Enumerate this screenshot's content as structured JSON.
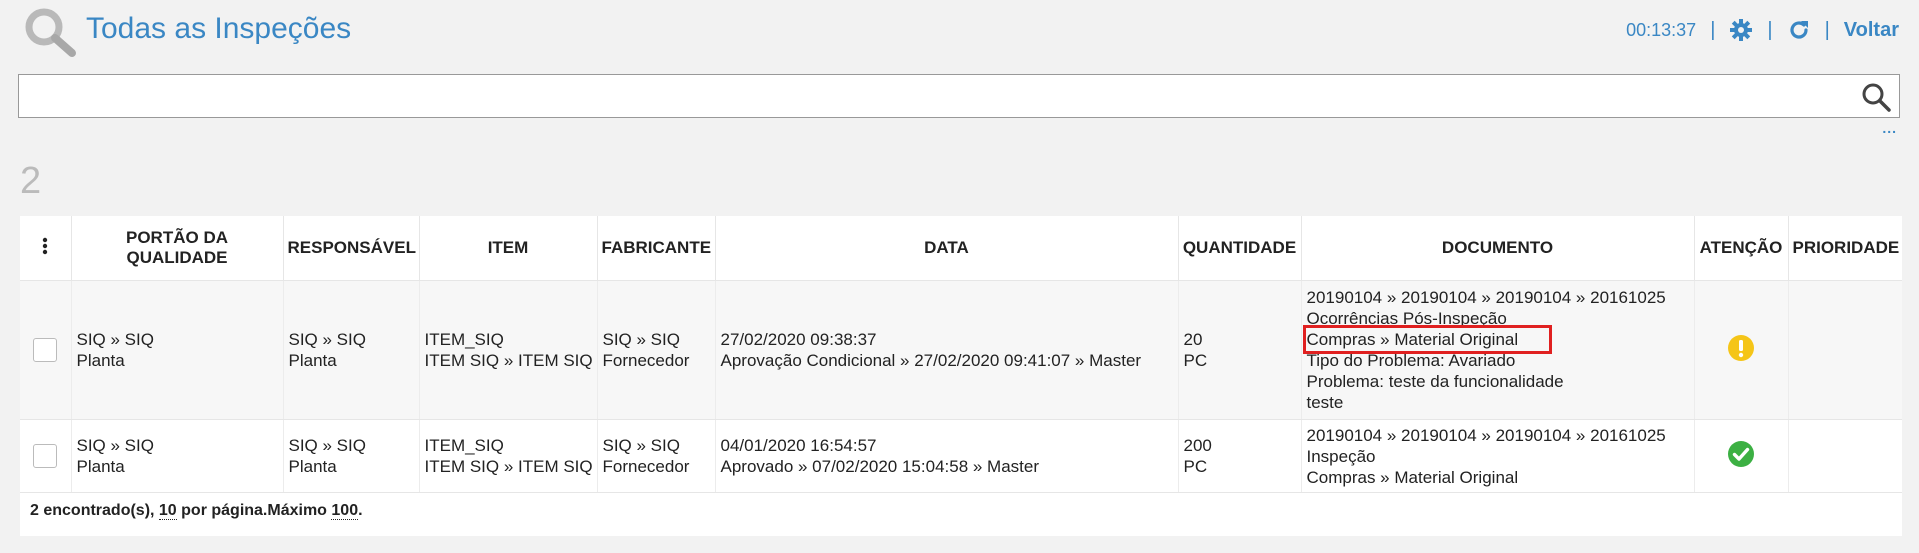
{
  "header": {
    "title": "Todas as Inspeções",
    "timer": "00:13:37",
    "sep": "|",
    "back_label": "Voltar"
  },
  "search": {
    "value": "",
    "placeholder": "",
    "more": "..."
  },
  "count": "2",
  "table": {
    "columns": [
      "PORTÃO DA QUALIDADE",
      "RESPONSÁVEL",
      "ITEM",
      "FABRICANTE",
      "DATA",
      "QUANTIDADE",
      "DOCUMENTO",
      "ATENÇÃO",
      "PRIORIDADE"
    ],
    "rows": [
      {
        "portao": [
          "SIQ » SIQ",
          "Planta"
        ],
        "responsavel": [
          "SIQ » SIQ",
          "Planta"
        ],
        "item": [
          "ITEM_SIQ",
          "ITEM SIQ » ITEM SIQ"
        ],
        "fabricante": [
          "SIQ » SIQ",
          "Fornecedor"
        ],
        "data": [
          "27/02/2020 09:38:37",
          "Aprovação Condicional » 27/02/2020 09:41:07 » Master"
        ],
        "quantidade": [
          "20",
          "PC"
        ],
        "documento": [
          "20190104 » 20190104 » 20190104 » 20161025",
          "Ocorrências Pós-Inspeção",
          "Compras » Material Original",
          "Tipo do Problema: Avariado",
          "Problema: teste da funcionalidade",
          "teste"
        ],
        "atencao": "warning",
        "prioridade": ""
      },
      {
        "portao": [
          "SIQ » SIQ",
          "Planta"
        ],
        "responsavel": [
          "SIQ » SIQ",
          "Planta"
        ],
        "item": [
          "ITEM_SIQ",
          "ITEM SIQ » ITEM SIQ"
        ],
        "fabricante": [
          "SIQ » SIQ",
          "Fornecedor"
        ],
        "data": [
          "04/01/2020 16:54:57",
          "Aprovado » 07/02/2020 15:04:58 » Master"
        ],
        "quantidade": [
          "200",
          "PC"
        ],
        "documento": [
          "20190104 » 20190104 » 20190104 » 20161025",
          "Inspeção",
          "Compras » Material Original"
        ],
        "atencao": "ok",
        "prioridade": ""
      }
    ]
  },
  "footer": {
    "found": "2 encontrado(s), ",
    "per_page": "10",
    "per_page_suffix": " por página.Máximo ",
    "max": "100",
    "end": "."
  },
  "colors": {
    "accent": "#3a87c4",
    "warning": "#f5c518",
    "ok": "#3cb043",
    "highlight": "#e02020"
  },
  "icons": {
    "title": "magnifier-icon",
    "settings": "gear-icon",
    "refresh": "refresh-icon",
    "search": "search-icon",
    "menu": "vertical-dots-icon",
    "warning": "warning-icon",
    "ok": "check-circle-icon"
  }
}
